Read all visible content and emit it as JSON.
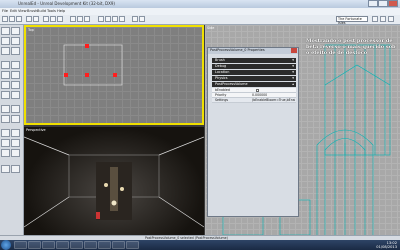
{
  "window": {
    "title": "UnrealEd - Unreal Development Kit (32-bit, DX9)"
  },
  "menu": [
    "File",
    "Edit",
    "View",
    "Brush",
    "Build",
    "Tools",
    "Help"
  ],
  "toolbar": {
    "selector_value": "The Fortunate Isles"
  },
  "viewports": {
    "top_label": "Top",
    "perspective_label": "Perspective",
    "side_label": "Side"
  },
  "properties": {
    "title": "PostProcessVolume_0 Properties",
    "categories": [
      "Brush",
      "Debug",
      "Location",
      "Physics",
      "PostProcessVolume"
    ],
    "rows": [
      {
        "name": "bEnabled",
        "value": ""
      },
      {
        "name": "Priority",
        "value": "0.000000"
      },
      {
        "name": "Settings",
        "value": "(bEnableBloom=True,bEnableDOF=..."
      }
    ]
  },
  "note": {
    "text": "Mostrando o post processor de beta reverso o mais querido sob o efeito de de desfoco"
  },
  "status": {
    "text": "PostProcessVolume_0 selected (PostProcessVolume)"
  },
  "clock": {
    "time": "13:02",
    "date": "01/08/2013"
  },
  "colors": {
    "selection": "#f0e000",
    "vertex": "#ff1e1e",
    "architecture": "#00b4b4"
  }
}
